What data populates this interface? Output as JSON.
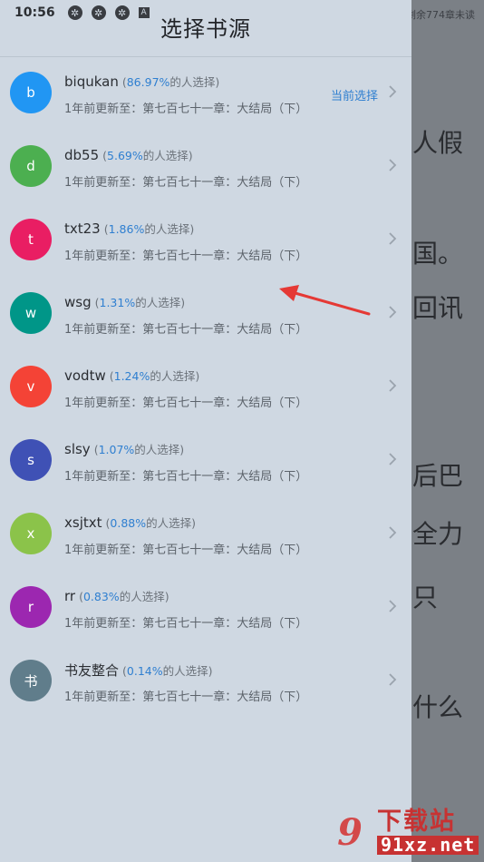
{
  "status_bar": {
    "time": "10:56",
    "icons": [
      "sync-icon",
      "sync-icon",
      "sync-icon",
      "a-icon"
    ],
    "icon_glyph": "✲",
    "a_glyph": "A"
  },
  "reader": {
    "status_text": "剩余774章未读",
    "lines": [
      "人假",
      "国。",
      "回讯",
      "后巴",
      "全力",
      "只",
      "什么"
    ]
  },
  "drawer": {
    "title": "选择书源",
    "current_label": "当前选择",
    "pct_prefix": "(",
    "pct_suffix": "的人选择)",
    "sources": [
      {
        "name": "biqukan",
        "initial": "b",
        "color": "#2196f3",
        "percent": "86.97%",
        "update": "1年前更新至：第七百七十一章：大结局（下）",
        "current": true
      },
      {
        "name": "db55",
        "initial": "d",
        "color": "#4caf50",
        "percent": "5.69%",
        "update": "1年前更新至：第七百七十一章：大结局（下）",
        "current": false
      },
      {
        "name": "txt23",
        "initial": "t",
        "color": "#e91e63",
        "percent": "1.86%",
        "update": "1年前更新至：第七百七十一章：大结局（下）",
        "current": false
      },
      {
        "name": "wsg",
        "initial": "w",
        "color": "#009688",
        "percent": "1.31%",
        "update": "1年前更新至：第七百七十一章：大结局（下）",
        "current": false
      },
      {
        "name": "vodtw",
        "initial": "v",
        "color": "#f44336",
        "percent": "1.24%",
        "update": "1年前更新至：第七百七十一章：大结局（下）",
        "current": false
      },
      {
        "name": "slsy",
        "initial": "s",
        "color": "#3f51b5",
        "percent": "1.07%",
        "update": "1年前更新至：第七百七十一章：大结局（下）",
        "current": false
      },
      {
        "name": "xsjtxt",
        "initial": "x",
        "color": "#8bc34a",
        "percent": "0.88%",
        "update": "1年前更新至：第七百七十一章：大结局（下）",
        "current": false
      },
      {
        "name": "rr",
        "initial": "r",
        "color": "#9c27b0",
        "percent": "0.83%",
        "update": "1年前更新至：第七百七十一章：大结局（下）",
        "current": false
      },
      {
        "name": "书友整合",
        "initial": "书",
        "color": "#607d8b",
        "percent": "0.14%",
        "update": "1年前更新至：第七百七十一章：大结局（下）",
        "current": false
      }
    ]
  },
  "watermark": {
    "logo": "9",
    "top": "下载站",
    "bottom": "91xz.net"
  },
  "colors": {
    "accent": "#2f7fd0",
    "arrow": "#e53935"
  }
}
